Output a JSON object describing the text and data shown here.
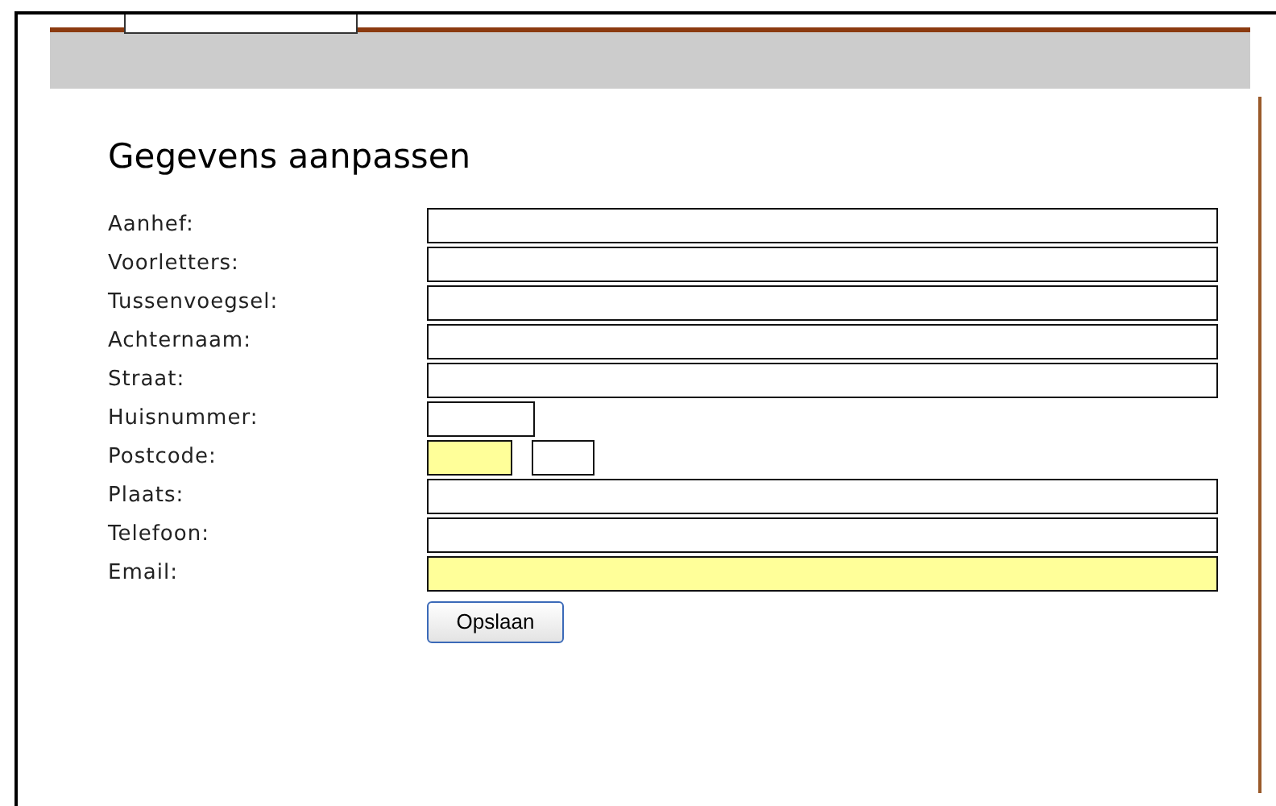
{
  "title": "Gegevens aanpassen",
  "fields": [
    {
      "label": "Aanhef:",
      "inputs": [
        {
          "kind": "wide",
          "highlighted": false
        }
      ]
    },
    {
      "label": "Voorletters:",
      "inputs": [
        {
          "kind": "wide",
          "highlighted": false
        }
      ]
    },
    {
      "label": "Tussenvoegsel:",
      "inputs": [
        {
          "kind": "wide",
          "highlighted": false
        }
      ]
    },
    {
      "label": "Achternaam:",
      "inputs": [
        {
          "kind": "wide",
          "highlighted": false
        }
      ]
    },
    {
      "label": "Straat:",
      "inputs": [
        {
          "kind": "wide",
          "highlighted": false
        }
      ]
    },
    {
      "label": "Huisnummer:",
      "inputs": [
        {
          "kind": "medium",
          "highlighted": false
        }
      ]
    },
    {
      "label": "Postcode:",
      "inputs": [
        {
          "kind": "small",
          "highlighted": true
        },
        {
          "kind": "tiny",
          "highlighted": false
        }
      ]
    },
    {
      "label": "Plaats:",
      "inputs": [
        {
          "kind": "wide",
          "highlighted": false
        }
      ]
    },
    {
      "label": "Telefoon:",
      "inputs": [
        {
          "kind": "wide",
          "highlighted": false
        }
      ]
    },
    {
      "label": "Email:",
      "inputs": [
        {
          "kind": "wide",
          "highlighted": true
        }
      ]
    }
  ],
  "save_button": "Opslaan"
}
